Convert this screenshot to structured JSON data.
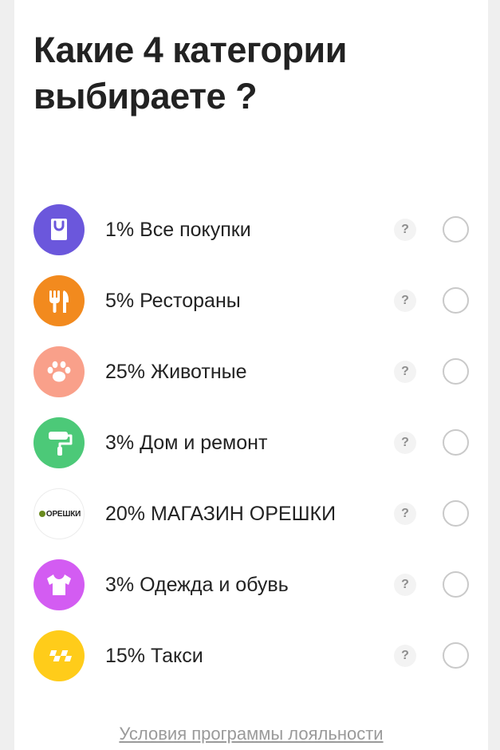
{
  "title": "Какие 4 категории выбираете ?",
  "categories": [
    {
      "label": "1% Все покупки",
      "icon": "shopping-bag-icon",
      "color": "#6b57dc"
    },
    {
      "label": "5% Рестораны",
      "icon": "fork-knife-icon",
      "color": "#f28a1e"
    },
    {
      "label": "25% Животные",
      "icon": "paw-icon",
      "color": "#f9a08a"
    },
    {
      "label": "3% Дом и ремонт",
      "icon": "paint-roller-icon",
      "color": "#4cc978"
    },
    {
      "label": "20% МАГАЗИН ОРЕШКИ",
      "icon": "oreshki-logo",
      "brand": "ОРЕШКИ",
      "color": "#ffffff"
    },
    {
      "label": "3% Одежда и обувь",
      "icon": "tshirt-icon",
      "color": "#d35cf2"
    },
    {
      "label": "15% Такси",
      "icon": "taxi-checker-icon",
      "color": "#ffcc1a"
    }
  ],
  "help_label": "?",
  "footer": {
    "terms_link": "Условия программы лояльности"
  }
}
